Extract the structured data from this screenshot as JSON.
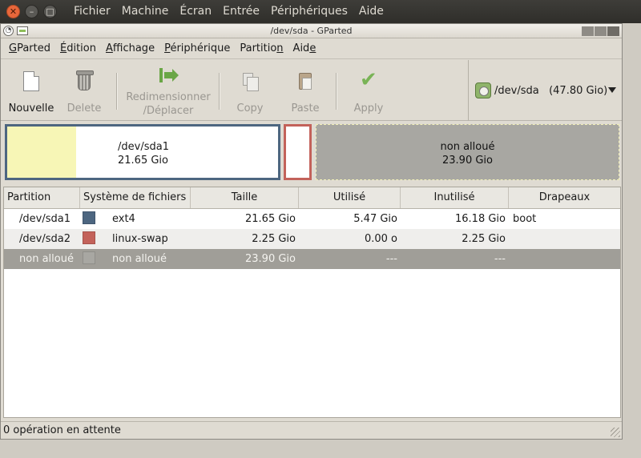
{
  "host": {
    "menu": [
      "Fichier",
      "Machine",
      "Écran",
      "Entrée",
      "Périphériques",
      "Aide"
    ],
    "window_buttons": [
      "close-icon",
      "minimize-icon",
      "maximize-icon"
    ]
  },
  "window": {
    "title": "/dev/sda - GParted"
  },
  "menubar": {
    "items": [
      {
        "mnemonic": "G",
        "rest": "Parted"
      },
      {
        "mnemonic": "É",
        "rest": "dition"
      },
      {
        "mnemonic": "A",
        "rest": "ffichage"
      },
      {
        "mnemonic": "P",
        "rest": "ériphérique"
      },
      {
        "pre": "Partitio",
        "mnemonic": "n",
        "rest": ""
      },
      {
        "pre": "Aid",
        "mnemonic": "e",
        "rest": ""
      }
    ]
  },
  "toolbar": {
    "new": "Nouvelle",
    "delete": "Delete",
    "resize_line1": "Redimensionner",
    "resize_line2": "/Déplacer",
    "copy": "Copy",
    "paste": "Paste",
    "apply": "Apply",
    "device": "/dev/sda   (47.80 Gio)"
  },
  "diskmap": {
    "sda1_name": "/dev/sda1",
    "sda1_size": "21.65 Gio",
    "unalloc_name": "non alloué",
    "unalloc_size": "23.90 Gio",
    "sda1_used_fraction": 0.253
  },
  "table": {
    "headers": [
      "Partition",
      "Système de fichiers",
      "Taille",
      "Utilisé",
      "Inutilisé",
      "Drapeaux"
    ],
    "rows": [
      {
        "partition": "/dev/sda1",
        "fs_color": "#4d6680",
        "fs": "ext4",
        "size": "21.65 Gio",
        "used": "5.47 Gio",
        "unused": "16.18 Gio",
        "flags": "boot"
      },
      {
        "partition": "/dev/sda2",
        "fs_color": "#c3625a",
        "fs": "linux-swap",
        "size": "2.25 Gio",
        "used": "0.00 o",
        "unused": "2.25 Gio",
        "flags": ""
      },
      {
        "partition": "non alloué",
        "fs_color": "#a8a7a2",
        "fs": "non alloué",
        "size": "23.90 Gio",
        "used": "---",
        "unused": "---",
        "flags": ""
      }
    ]
  },
  "status": {
    "text": "0 opération en attente"
  }
}
